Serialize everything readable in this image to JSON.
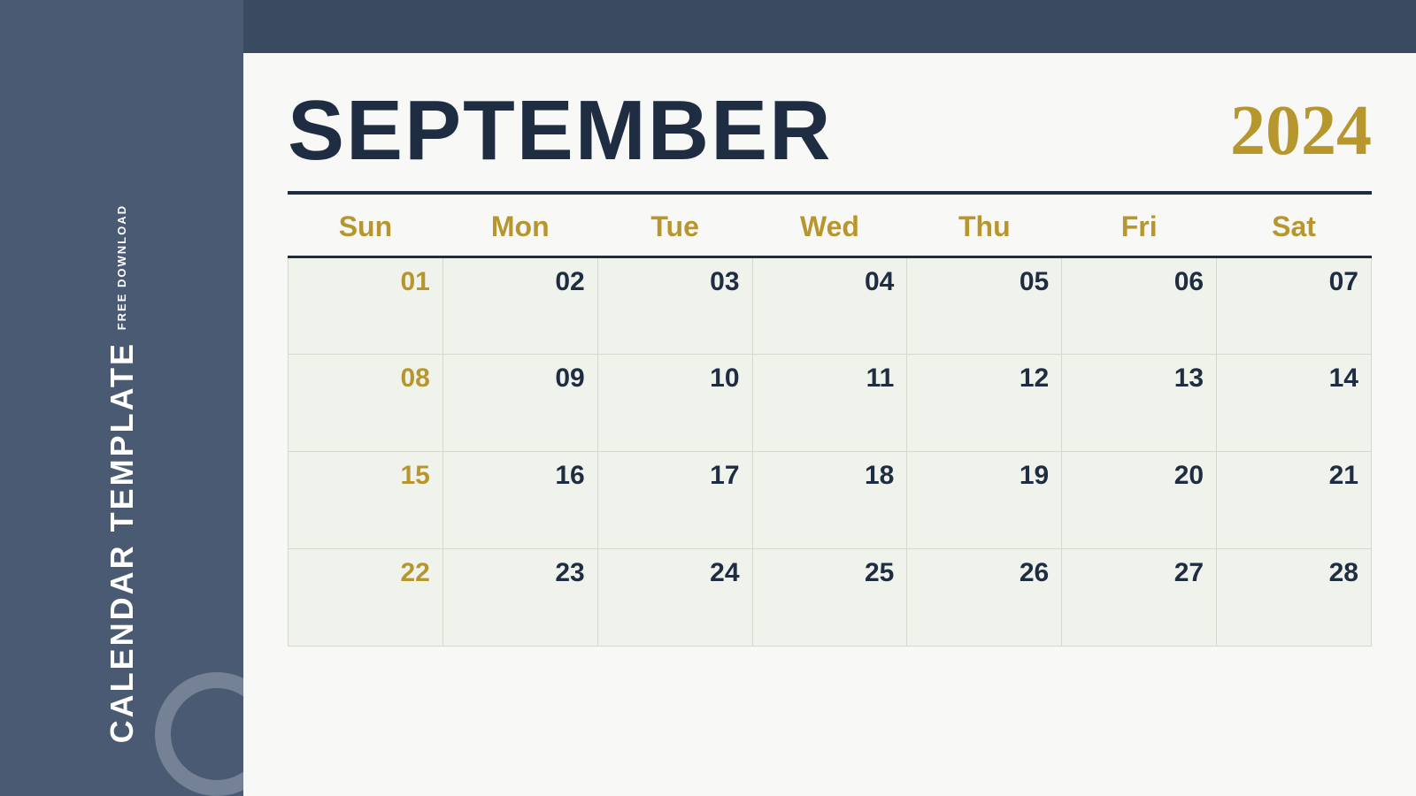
{
  "sidebar": {
    "free_download": "FREE DOWNLOAD",
    "calendar_template": "CALENDAR TEMPLATE"
  },
  "header": {
    "month": "SEPTEMBER",
    "year": "2024"
  },
  "days_of_week": [
    "Sun",
    "Mon",
    "Tue",
    "Wed",
    "Thu",
    "Fri",
    "Sat"
  ],
  "weeks": [
    [
      {
        "num": "01",
        "type": "sunday"
      },
      {
        "num": "02",
        "type": "regular"
      },
      {
        "num": "03",
        "type": "regular"
      },
      {
        "num": "04",
        "type": "regular"
      },
      {
        "num": "05",
        "type": "regular"
      },
      {
        "num": "06",
        "type": "regular"
      },
      {
        "num": "07",
        "type": "regular"
      }
    ],
    [
      {
        "num": "08",
        "type": "sunday"
      },
      {
        "num": "09",
        "type": "regular"
      },
      {
        "num": "10",
        "type": "regular"
      },
      {
        "num": "11",
        "type": "regular"
      },
      {
        "num": "12",
        "type": "regular"
      },
      {
        "num": "13",
        "type": "regular"
      },
      {
        "num": "14",
        "type": "regular"
      }
    ],
    [
      {
        "num": "15",
        "type": "sunday"
      },
      {
        "num": "16",
        "type": "regular"
      },
      {
        "num": "17",
        "type": "regular"
      },
      {
        "num": "18",
        "type": "regular"
      },
      {
        "num": "19",
        "type": "regular"
      },
      {
        "num": "20",
        "type": "regular"
      },
      {
        "num": "21",
        "type": "regular"
      }
    ],
    [
      {
        "num": "22",
        "type": "sunday"
      },
      {
        "num": "23",
        "type": "regular"
      },
      {
        "num": "24",
        "type": "regular"
      },
      {
        "num": "25",
        "type": "regular"
      },
      {
        "num": "26",
        "type": "regular"
      },
      {
        "num": "27",
        "type": "regular"
      },
      {
        "num": "28",
        "type": "regular"
      }
    ]
  ],
  "colors": {
    "background": "#4a5a72",
    "card_bg": "#f8f8f6",
    "navy": "#1e2d42",
    "gold": "#b8962e",
    "cell_bg": "#f0f2ec",
    "border": "#d5d8cc"
  }
}
